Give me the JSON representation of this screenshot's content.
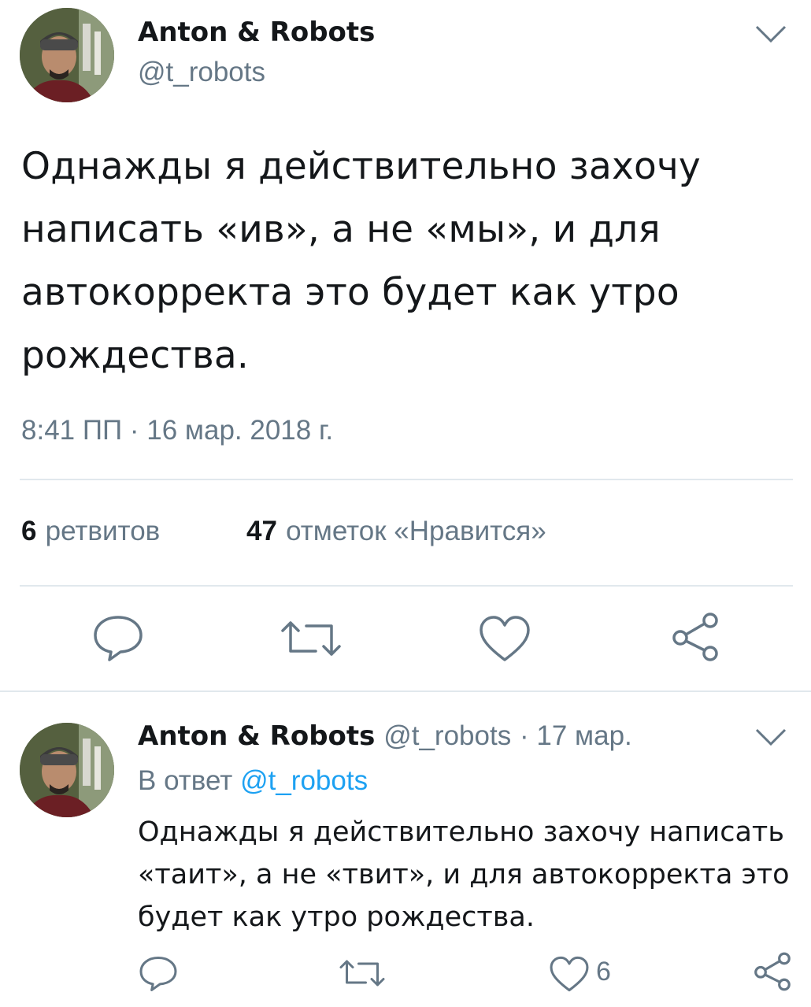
{
  "main_tweet": {
    "author_name": "Anton & Robots",
    "author_handle": "@t_robots",
    "text": "Однажды я действительно захочу написать «ив», а не «мы», и для автокорректа это будет как утро рождества.",
    "timestamp": "8:41 ПП · 16 мар. 2018 г.",
    "stats": {
      "retweets_count": "6",
      "retweets_label": "ретвитов",
      "likes_count": "47",
      "likes_label": "отметок «Нравится»"
    },
    "actions": [
      "reply-icon",
      "retweet-icon",
      "like-icon",
      "share-icon"
    ]
  },
  "reply_tweet": {
    "author_name": "Anton & Robots",
    "author_handle": "@t_robots",
    "date": "· 17 мар.",
    "reply_prefix": "В ответ",
    "reply_to": "@t_robots",
    "text": "Однажды я действительно захочу написать «таит», а не «твит», и для автокорректа это будет как утро рождества.",
    "likes_count": "6",
    "actions": [
      "reply-icon",
      "retweet-icon",
      "like-icon",
      "share-icon"
    ]
  },
  "colors": {
    "text": "#14171a",
    "secondary": "#657786",
    "link": "#1da1f2",
    "divider": "#e1e8ed"
  }
}
